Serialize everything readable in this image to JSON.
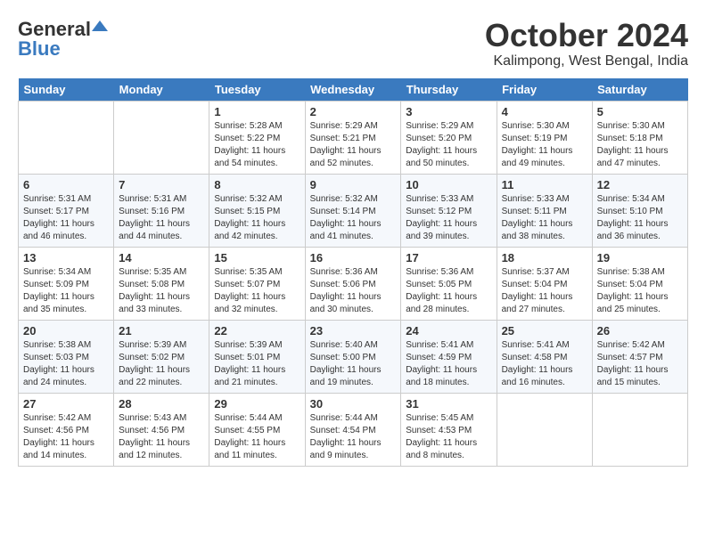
{
  "header": {
    "logo_general": "General",
    "logo_blue": "Blue",
    "month": "October 2024",
    "location": "Kalimpong, West Bengal, India"
  },
  "days": [
    "Sunday",
    "Monday",
    "Tuesday",
    "Wednesday",
    "Thursday",
    "Friday",
    "Saturday"
  ],
  "weeks": [
    [
      {
        "date": "",
        "sunrise": "",
        "sunset": "",
        "daylight": ""
      },
      {
        "date": "",
        "sunrise": "",
        "sunset": "",
        "daylight": ""
      },
      {
        "date": "1",
        "sunrise": "Sunrise: 5:28 AM",
        "sunset": "Sunset: 5:22 PM",
        "daylight": "Daylight: 11 hours and 54 minutes."
      },
      {
        "date": "2",
        "sunrise": "Sunrise: 5:29 AM",
        "sunset": "Sunset: 5:21 PM",
        "daylight": "Daylight: 11 hours and 52 minutes."
      },
      {
        "date": "3",
        "sunrise": "Sunrise: 5:29 AM",
        "sunset": "Sunset: 5:20 PM",
        "daylight": "Daylight: 11 hours and 50 minutes."
      },
      {
        "date": "4",
        "sunrise": "Sunrise: 5:30 AM",
        "sunset": "Sunset: 5:19 PM",
        "daylight": "Daylight: 11 hours and 49 minutes."
      },
      {
        "date": "5",
        "sunrise": "Sunrise: 5:30 AM",
        "sunset": "Sunset: 5:18 PM",
        "daylight": "Daylight: 11 hours and 47 minutes."
      }
    ],
    [
      {
        "date": "6",
        "sunrise": "Sunrise: 5:31 AM",
        "sunset": "Sunset: 5:17 PM",
        "daylight": "Daylight: 11 hours and 46 minutes."
      },
      {
        "date": "7",
        "sunrise": "Sunrise: 5:31 AM",
        "sunset": "Sunset: 5:16 PM",
        "daylight": "Daylight: 11 hours and 44 minutes."
      },
      {
        "date": "8",
        "sunrise": "Sunrise: 5:32 AM",
        "sunset": "Sunset: 5:15 PM",
        "daylight": "Daylight: 11 hours and 42 minutes."
      },
      {
        "date": "9",
        "sunrise": "Sunrise: 5:32 AM",
        "sunset": "Sunset: 5:14 PM",
        "daylight": "Daylight: 11 hours and 41 minutes."
      },
      {
        "date": "10",
        "sunrise": "Sunrise: 5:33 AM",
        "sunset": "Sunset: 5:12 PM",
        "daylight": "Daylight: 11 hours and 39 minutes."
      },
      {
        "date": "11",
        "sunrise": "Sunrise: 5:33 AM",
        "sunset": "Sunset: 5:11 PM",
        "daylight": "Daylight: 11 hours and 38 minutes."
      },
      {
        "date": "12",
        "sunrise": "Sunrise: 5:34 AM",
        "sunset": "Sunset: 5:10 PM",
        "daylight": "Daylight: 11 hours and 36 minutes."
      }
    ],
    [
      {
        "date": "13",
        "sunrise": "Sunrise: 5:34 AM",
        "sunset": "Sunset: 5:09 PM",
        "daylight": "Daylight: 11 hours and 35 minutes."
      },
      {
        "date": "14",
        "sunrise": "Sunrise: 5:35 AM",
        "sunset": "Sunset: 5:08 PM",
        "daylight": "Daylight: 11 hours and 33 minutes."
      },
      {
        "date": "15",
        "sunrise": "Sunrise: 5:35 AM",
        "sunset": "Sunset: 5:07 PM",
        "daylight": "Daylight: 11 hours and 32 minutes."
      },
      {
        "date": "16",
        "sunrise": "Sunrise: 5:36 AM",
        "sunset": "Sunset: 5:06 PM",
        "daylight": "Daylight: 11 hours and 30 minutes."
      },
      {
        "date": "17",
        "sunrise": "Sunrise: 5:36 AM",
        "sunset": "Sunset: 5:05 PM",
        "daylight": "Daylight: 11 hours and 28 minutes."
      },
      {
        "date": "18",
        "sunrise": "Sunrise: 5:37 AM",
        "sunset": "Sunset: 5:04 PM",
        "daylight": "Daylight: 11 hours and 27 minutes."
      },
      {
        "date": "19",
        "sunrise": "Sunrise: 5:38 AM",
        "sunset": "Sunset: 5:04 PM",
        "daylight": "Daylight: 11 hours and 25 minutes."
      }
    ],
    [
      {
        "date": "20",
        "sunrise": "Sunrise: 5:38 AM",
        "sunset": "Sunset: 5:03 PM",
        "daylight": "Daylight: 11 hours and 24 minutes."
      },
      {
        "date": "21",
        "sunrise": "Sunrise: 5:39 AM",
        "sunset": "Sunset: 5:02 PM",
        "daylight": "Daylight: 11 hours and 22 minutes."
      },
      {
        "date": "22",
        "sunrise": "Sunrise: 5:39 AM",
        "sunset": "Sunset: 5:01 PM",
        "daylight": "Daylight: 11 hours and 21 minutes."
      },
      {
        "date": "23",
        "sunrise": "Sunrise: 5:40 AM",
        "sunset": "Sunset: 5:00 PM",
        "daylight": "Daylight: 11 hours and 19 minutes."
      },
      {
        "date": "24",
        "sunrise": "Sunrise: 5:41 AM",
        "sunset": "Sunset: 4:59 PM",
        "daylight": "Daylight: 11 hours and 18 minutes."
      },
      {
        "date": "25",
        "sunrise": "Sunrise: 5:41 AM",
        "sunset": "Sunset: 4:58 PM",
        "daylight": "Daylight: 11 hours and 16 minutes."
      },
      {
        "date": "26",
        "sunrise": "Sunrise: 5:42 AM",
        "sunset": "Sunset: 4:57 PM",
        "daylight": "Daylight: 11 hours and 15 minutes."
      }
    ],
    [
      {
        "date": "27",
        "sunrise": "Sunrise: 5:42 AM",
        "sunset": "Sunset: 4:56 PM",
        "daylight": "Daylight: 11 hours and 14 minutes."
      },
      {
        "date": "28",
        "sunrise": "Sunrise: 5:43 AM",
        "sunset": "Sunset: 4:56 PM",
        "daylight": "Daylight: 11 hours and 12 minutes."
      },
      {
        "date": "29",
        "sunrise": "Sunrise: 5:44 AM",
        "sunset": "Sunset: 4:55 PM",
        "daylight": "Daylight: 11 hours and 11 minutes."
      },
      {
        "date": "30",
        "sunrise": "Sunrise: 5:44 AM",
        "sunset": "Sunset: 4:54 PM",
        "daylight": "Daylight: 11 hours and 9 minutes."
      },
      {
        "date": "31",
        "sunrise": "Sunrise: 5:45 AM",
        "sunset": "Sunset: 4:53 PM",
        "daylight": "Daylight: 11 hours and 8 minutes."
      },
      {
        "date": "",
        "sunrise": "",
        "sunset": "",
        "daylight": ""
      },
      {
        "date": "",
        "sunrise": "",
        "sunset": "",
        "daylight": ""
      }
    ]
  ]
}
